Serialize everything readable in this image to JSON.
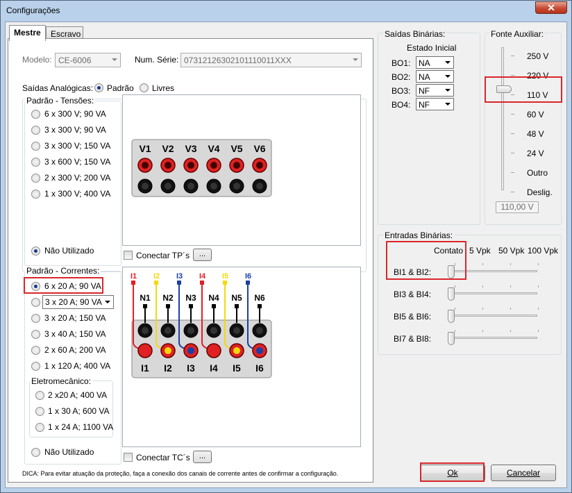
{
  "window": {
    "title": "Configurações",
    "close_label": "✕"
  },
  "tabs": [
    {
      "label": "Mestre"
    },
    {
      "label": "Escravo"
    }
  ],
  "modelo": {
    "label": "Modelo:",
    "value": "CE-6006"
  },
  "serie": {
    "label": "Num. Série:",
    "value": "07312126302101110011XXX"
  },
  "saidas_analogicas": {
    "label": "Saídas Analógicas:",
    "opt_padrao": "Padrão",
    "opt_livres": "Livres"
  },
  "tensoes": {
    "title": "Padrão - Tensões:",
    "options": [
      "6 x 300 V; 90 VA",
      "3 x 300 V; 90 VA",
      "3 x 300 V; 150 VA",
      "3 x 600 V; 150 VA",
      "2 x 300 V; 200 VA",
      "1 x 300 V; 400 VA"
    ],
    "nao_utilizado": "Não Utilizado",
    "channels": [
      "V1",
      "V2",
      "V3",
      "V4",
      "V5",
      "V6"
    ]
  },
  "conectar_tp": {
    "label": "Conectar TP´s",
    "button": "..."
  },
  "correntes": {
    "title": "Padrão - Correntes:",
    "opt0": "6 x 20 A; 90 VA",
    "opt1_select": "3 x 20 A; 90 VA",
    "options": [
      "3 x 20 A; 150 VA",
      "3 x 40 A; 150 VA",
      "2 x 60 A; 200 VA",
      "1 x 120 A; 400 VA"
    ],
    "eletromecanico": {
      "title": "Eletromecânico:",
      "options": [
        "2 x20 A; 400 VA",
        "1 x 30 A; 600 VA",
        "1 x 24 A; 1100 VA"
      ]
    },
    "nao_utilizado": "Não Utilizado",
    "top_labels": [
      "I1",
      "I2",
      "I3",
      "I4",
      "I5",
      "I6"
    ],
    "n_labels": [
      "N1",
      "N2",
      "N3",
      "N4",
      "N5",
      "N6"
    ],
    "bottom_labels": [
      "I1",
      "I2",
      "I3",
      "I4",
      "I5",
      "I6"
    ],
    "colors": [
      "#e31e24",
      "#f5d90a",
      "#1b3fa6",
      "#e31e24",
      "#f5d90a",
      "#1b3fa6"
    ]
  },
  "conectar_tc": {
    "label": "Conectar TC´s",
    "button": "..."
  },
  "dica": "DICA: Para evitar atuação da proteção, faça a conexão dos canais de corrente antes de confirmar a configuração.",
  "saidas_binarias": {
    "title": "Saídas Binárias:",
    "estado_inicial": "Estado Inicial",
    "items": [
      {
        "label": "BO1:",
        "value": "NA"
      },
      {
        "label": "BO2:",
        "value": "NA"
      },
      {
        "label": "BO3:",
        "value": "NF"
      },
      {
        "label": "BO4:",
        "value": "NF"
      }
    ]
  },
  "fonte_auxiliar": {
    "title": "Fonte Auxiliar:",
    "levels": [
      "250 V",
      "220 V",
      "110 V",
      "60 V",
      "48 V",
      "24 V",
      "Outro",
      "Deslig."
    ],
    "selected": "110 V",
    "readout": "110,00 V"
  },
  "entradas_binarias": {
    "title": "Entradas Binárias:",
    "scale": [
      "Contato",
      "5 Vpk",
      "50 Vpk",
      "100 Vpk"
    ],
    "rows": [
      {
        "label": "BI1 & BI2:",
        "value": "Contato"
      },
      {
        "label": "BI3 & BI4:",
        "value": "Contato"
      },
      {
        "label": "BI5 & BI6:",
        "value": "Contato"
      },
      {
        "label": "BI7 & BI8:",
        "value": "Contato"
      }
    ]
  },
  "buttons": {
    "ok": "Ok",
    "cancel": "Cancelar"
  },
  "accent": {
    "highlight": "#d9262b",
    "selection": "#16358c"
  }
}
